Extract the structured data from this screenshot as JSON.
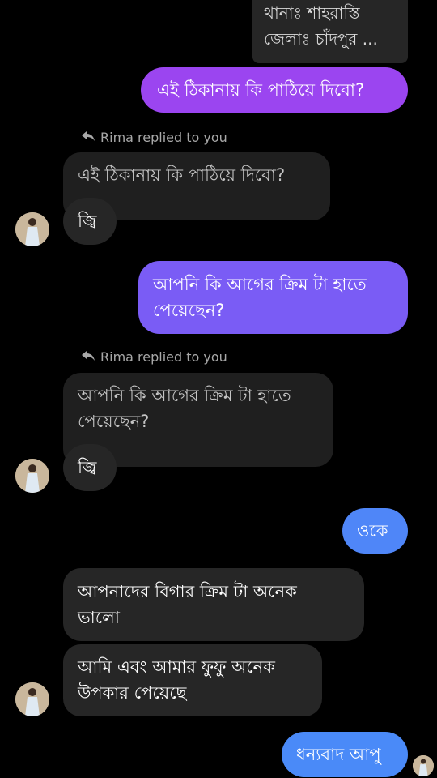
{
  "messages": {
    "top_address_line1": "থানাঃ শাহরাস্তি",
    "top_address_line2": "জেলাঃ চাঁদপুর ...",
    "m1": "এই ঠিকানায় কি পাঠিয়ে দিবো?",
    "reply1_label": "Rima replied to you",
    "reply1_quote": "এই ঠিকানায় কি পাঠিয়ে দিবো?",
    "reply1_text": "জ্বি",
    "m2_line1": "আপনি কি আগের ক্রিম টা হাতে",
    "m2_line2": "পেয়েছেন?",
    "reply2_label": "Rima replied to you",
    "reply2_quote_line1": "আপনি কি আগের ক্রিম টা হাতে",
    "reply2_quote_line2": "পেয়েছেন?",
    "reply2_text": "জ্বি",
    "m3": "ওকে",
    "in3_line1": "আপনাদের বিগার ক্রিম টা অনেক",
    "in3_line2": "ভালো",
    "in4_line1": "আমি এবং আমার ফুফু অনেক",
    "in4_line2": "উপকার পেয়েছে",
    "m4": "ধন্যবাদ আপু"
  },
  "icons": {
    "reply_arrow": "reply-arrow-icon",
    "avatar": "contact-avatar"
  },
  "colors": {
    "background": "#000000",
    "outgoing_purple": "#9b45f0",
    "outgoing_violet": "#7a5cf5",
    "outgoing_blue": "#4f86f8",
    "incoming": "#262626"
  }
}
